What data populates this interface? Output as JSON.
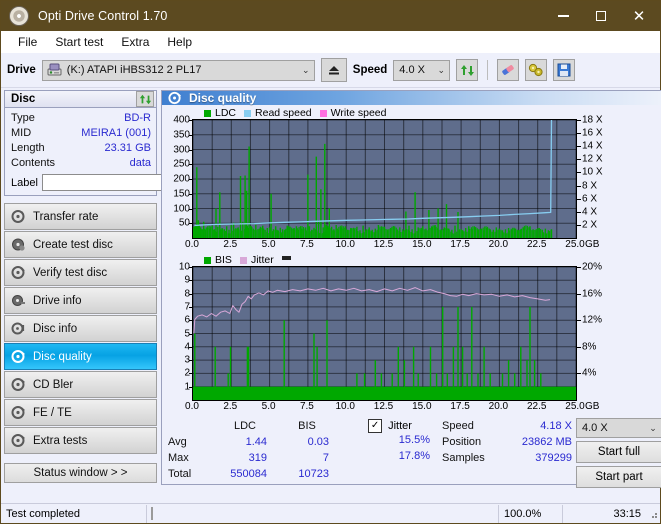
{
  "window": {
    "title": "Opti Drive Control 1.70",
    "icon": "disc-icon",
    "minimize": "minimize-icon",
    "maximize": "maximize-icon",
    "close": "close-icon"
  },
  "menu": {
    "items": [
      "File",
      "Start test",
      "Extra",
      "Help"
    ]
  },
  "toolbar": {
    "drive_label": "Drive",
    "drive_value": "(K:)  ATAPI iHBS312  2 PL17",
    "eject_icon": "eject-icon",
    "speed_label": "Speed",
    "speed_value": "4.0 X",
    "refresh_icon": "refresh-icon",
    "erase_icon": "eraser-icon",
    "disc_tools_icon": "disc-tools-icon",
    "save_icon": "save-icon"
  },
  "disc_panel": {
    "header": "Disc",
    "refresh_icon": "refresh-icon",
    "rows": [
      {
        "key": "Type",
        "value": "BD-R"
      },
      {
        "key": "MID",
        "value": "MEIRA1 (001)"
      },
      {
        "key": "Length",
        "value": "23.31 GB"
      },
      {
        "key": "Contents",
        "value": "data"
      }
    ],
    "label_key": "Label",
    "label_value": "",
    "label_placeholder": "",
    "label_button_icon": "cd-icon"
  },
  "sidebar": {
    "items": [
      {
        "label": "Transfer rate",
        "icon": "disc-transfer-icon",
        "active": false
      },
      {
        "label": "Create test disc",
        "icon": "disc-create-icon",
        "active": false
      },
      {
        "label": "Verify test disc",
        "icon": "disc-verify-icon",
        "active": false
      },
      {
        "label": "Drive info",
        "icon": "disc-drive-icon",
        "active": false
      },
      {
        "label": "Disc info",
        "icon": "disc-info-icon",
        "active": false
      },
      {
        "label": "Disc quality",
        "icon": "disc-quality-icon",
        "active": true
      },
      {
        "label": "CD Bler",
        "icon": "disc-bler-icon",
        "active": false
      },
      {
        "label": "FE / TE",
        "icon": "disc-fete-icon",
        "active": false
      },
      {
        "label": "Extra tests",
        "icon": "disc-extra-icon",
        "active": false
      }
    ],
    "status_button": "Status window > >"
  },
  "main": {
    "header": "Disc quality",
    "header_icon": "disc-quality-icon"
  },
  "stats": {
    "columns": [
      "LDC",
      "BIS"
    ],
    "rows": [
      {
        "label": "Avg",
        "ldc": "1.44",
        "bis": "0.03",
        "jitter": "15.5%"
      },
      {
        "label": "Max",
        "ldc": "319",
        "bis": "7",
        "jitter": "17.8%"
      },
      {
        "label": "Total",
        "ldc": "550084",
        "bis": "10723",
        "jitter": ""
      }
    ],
    "jitter_label": "Jitter",
    "jitter_checked": "✓",
    "speed_key": "Speed",
    "speed_value": "4.18 X",
    "position_key": "Position",
    "position_value": "23862 MB",
    "samples_key": "Samples",
    "samples_value": "379299",
    "speed_select": "4.0 X",
    "start_full": "Start full",
    "start_part": "Start part"
  },
  "statusbar": {
    "message": "Test completed",
    "percent_label": "100.0%",
    "percent_value": 100,
    "elapsed": "33:15"
  },
  "colors": {
    "ldc_green": "#00a800",
    "read_speed_blue": "#87cdf0",
    "write_speed_pink": "#ff6ee0",
    "jitter_pink": "#d8a8d8",
    "plot_bg": "#5f6d8c",
    "accent_blue": "#2a2ad0",
    "title_bar": "#5c4a20"
  },
  "chart_data": [
    {
      "type": "line",
      "name": "ldc-chart",
      "title": "",
      "xlabel": "GB",
      "ylabel": "",
      "xlim": [
        0,
        25
      ],
      "ylim": [
        0,
        400
      ],
      "y2lim": [
        0,
        18
      ],
      "y2label": "X",
      "grid": true,
      "legend": [
        {
          "label": "LDC",
          "color": "#00a800"
        },
        {
          "label": "Read speed",
          "color": "#87cdf0"
        },
        {
          "label": "Write speed",
          "color": "#ff6ee0"
        }
      ],
      "xticks": [
        0.0,
        2.5,
        5.0,
        7.5,
        10.0,
        12.5,
        15.0,
        17.5,
        20.0,
        22.5,
        25.0
      ],
      "xtick_labels": [
        "0.0",
        "2.5",
        "5.0",
        "7.5",
        "10.0",
        "12.5",
        "15.0",
        "17.5",
        "20.0",
        "22.5",
        "25.0"
      ],
      "yticks": [
        50,
        100,
        150,
        200,
        250,
        300,
        350,
        400
      ],
      "y2ticks": [
        2,
        4,
        6,
        8,
        10,
        12,
        14,
        16,
        18
      ],
      "y2tick_labels": [
        "2 X",
        "4 X",
        "6 X",
        "8 X",
        "10 X",
        "12 X",
        "14 X",
        "16 X",
        "18 X"
      ],
      "series": [
        {
          "name": "LDC",
          "color": "#00a800",
          "style": "impulse",
          "x": [
            0.05,
            0.15,
            0.25,
            0.35,
            0.42,
            0.5,
            0.6,
            0.7,
            0.8,
            0.95,
            1.1,
            1.25,
            1.4,
            1.5,
            1.62,
            1.75,
            1.9,
            2.05,
            2.2,
            2.35,
            2.5,
            2.65,
            2.8,
            2.95,
            3.1,
            3.25,
            3.4,
            3.5,
            3.58,
            3.66,
            3.8,
            3.95,
            4.1,
            4.25,
            4.4,
            4.55,
            4.7,
            4.85,
            5.0,
            5.1,
            5.25,
            5.4,
            5.55,
            5.7,
            5.85,
            6.0,
            6.15,
            6.3,
            6.45,
            6.6,
            6.75,
            6.9,
            7.05,
            7.2,
            7.35,
            7.5,
            7.6,
            7.75,
            7.9,
            8.05,
            8.2,
            8.35,
            8.5,
            8.6,
            8.7,
            8.8,
            8.9,
            9.05,
            9.2,
            9.35,
            9.5,
            9.65,
            9.8,
            9.95,
            10.1,
            10.3,
            10.5,
            10.7,
            10.9,
            11.1,
            11.3,
            11.5,
            11.7,
            11.9,
            12.1,
            12.3,
            12.5,
            12.7,
            12.9,
            13.1,
            13.3,
            13.5,
            13.7,
            13.9,
            14.1,
            14.3,
            14.5,
            14.7,
            14.9,
            15.0,
            15.2,
            15.4,
            15.6,
            15.8,
            16.0,
            16.2,
            16.4,
            16.55,
            16.7,
            16.9,
            17.1,
            17.3,
            17.5,
            17.6,
            17.8,
            18.0,
            18.2,
            18.4,
            18.6,
            18.8,
            19.0,
            19.2,
            19.4,
            19.6,
            19.8,
            20.0,
            20.2,
            20.4,
            20.6,
            20.8,
            21.0,
            21.2,
            21.4,
            21.6,
            21.8,
            22.0,
            22.2,
            22.4,
            22.6,
            22.8,
            23.0,
            23.2,
            23.4
          ],
          "y": [
            38,
            42,
            240,
            60,
            45,
            36,
            30,
            55,
            28,
            34,
            32,
            42,
            30,
            100,
            38,
            155,
            34,
            30,
            40,
            28,
            44,
            52,
            30,
            36,
            210,
            55,
            212,
            160,
            34,
            310,
            40,
            28,
            45,
            30,
            38,
            42,
            28,
            34,
            36,
            150,
            30,
            40,
            26,
            35,
            30,
            28,
            42,
            36,
            30,
            34,
            40,
            28,
            32,
            30,
            36,
            215,
            40,
            28,
            35,
            276,
            60,
            165,
            36,
            319,
            45,
            40,
            100,
            38,
            30,
            44,
            28,
            36,
            32,
            40,
            28,
            34,
            30,
            38,
            26,
            42,
            30,
            36,
            28,
            32,
            44,
            30,
            38,
            26,
            34,
            40,
            28,
            36,
            30,
            90,
            42,
            30,
            155,
            36,
            28,
            40,
            32,
            95,
            38,
            44,
            100,
            30,
            36,
            115,
            32,
            28,
            42,
            88,
            30,
            26,
            34,
            40,
            30,
            36,
            28,
            32,
            26,
            34,
            30,
            28,
            36,
            32,
            26,
            30,
            34,
            28,
            32,
            26,
            30,
            36,
            28,
            40,
            30,
            26,
            34,
            28,
            32,
            26,
            30
          ]
        },
        {
          "name": "Read speed",
          "color": "#87cdf0",
          "style": "line",
          "axis": "right",
          "x": [
            0.1,
            1.0,
            2.0,
            3.0,
            4.0,
            5.0,
            6.0,
            7.0,
            8.0,
            9.0,
            10.0,
            11.0,
            12.0,
            13.0,
            14.0,
            15.0,
            16.0,
            17.0,
            18.0,
            19.0,
            20.0,
            21.0,
            22.0,
            22.9,
            23.35,
            23.4
          ],
          "y": [
            1.9,
            2.05,
            2.1,
            2.15,
            2.2,
            2.3,
            2.4,
            2.45,
            2.55,
            2.62,
            2.7,
            2.75,
            2.8,
            2.85,
            2.9,
            3.0,
            3.08,
            3.15,
            3.25,
            3.35,
            3.45,
            3.6,
            3.72,
            3.85,
            3.9,
            18.0
          ]
        }
      ]
    },
    {
      "type": "line",
      "name": "bis-jitter-chart",
      "title": "",
      "xlabel": "GB",
      "ylabel": "",
      "xlim": [
        0,
        25
      ],
      "ylim": [
        0,
        10
      ],
      "y2lim": [
        0,
        20
      ],
      "y2label": "%",
      "grid": true,
      "legend": [
        {
          "label": "BIS",
          "color": "#00a800"
        },
        {
          "label": "Jitter",
          "color": "#d8a8d8"
        }
      ],
      "xticks": [
        0.0,
        2.5,
        5.0,
        7.5,
        10.0,
        12.5,
        15.0,
        17.5,
        20.0,
        22.5,
        25.0
      ],
      "xtick_labels": [
        "0.0",
        "2.5",
        "5.0",
        "7.5",
        "10.0",
        "12.5",
        "15.0",
        "17.5",
        "20.0",
        "22.5",
        "25.0"
      ],
      "yticks": [
        1,
        2,
        3,
        4,
        5,
        6,
        7,
        8,
        9,
        10
      ],
      "y2ticks": [
        4,
        8,
        12,
        16,
        20
      ],
      "y2tick_labels": [
        "4%",
        "8%",
        "12%",
        "16%",
        "20%"
      ],
      "series": [
        {
          "name": "BIS",
          "color": "#00a800",
          "style": "impulse",
          "baseline": 1,
          "x": [
            0.12,
            0.5,
            1.0,
            1.45,
            1.8,
            2.3,
            2.45,
            2.9,
            3.3,
            3.55,
            3.62,
            4.1,
            4.6,
            5.0,
            5.4,
            5.95,
            6.4,
            6.9,
            7.4,
            7.9,
            8.1,
            8.45,
            8.75,
            9.2,
            9.7,
            10.2,
            10.7,
            11.2,
            11.5,
            11.9,
            12.3,
            12.6,
            13.0,
            13.4,
            13.8,
            14.1,
            14.4,
            14.7,
            15.1,
            15.5,
            15.9,
            16.3,
            16.6,
            17.0,
            17.3,
            17.6,
            17.9,
            18.2,
            18.6,
            19.0,
            19.4,
            19.8,
            20.2,
            20.6,
            21.0,
            21.4,
            21.8,
            22.0,
            22.3,
            22.7,
            23.0,
            23.3
          ],
          "y": [
            5,
            1,
            1,
            4,
            1,
            2,
            4,
            1,
            1,
            4,
            4,
            1,
            1,
            1,
            1,
            6,
            1,
            1,
            1,
            5,
            4,
            1,
            6,
            1,
            1,
            1,
            2,
            2,
            1,
            3,
            2,
            1,
            2,
            4,
            3,
            1,
            4,
            2,
            1,
            4,
            2,
            7,
            2,
            4,
            7,
            4,
            2,
            7,
            2,
            4,
            2,
            1,
            2,
            3,
            2,
            4,
            3,
            7,
            3,
            2,
            1,
            1
          ]
        },
        {
          "name": "Jitter",
          "color": "#d8a8d8",
          "style": "line",
          "axis": "right",
          "x": [
            0.05,
            0.12,
            0.3,
            0.6,
            0.9,
            1.2,
            1.5,
            1.8,
            2.1,
            2.4,
            2.6,
            2.8,
            3.0,
            3.2,
            3.4,
            3.6,
            3.8,
            4.0,
            4.3,
            4.6,
            4.9,
            5.2,
            5.5,
            6.0,
            6.5,
            7.0,
            7.5,
            8.0,
            8.5,
            9.0,
            9.5,
            10.0,
            10.5,
            11.0,
            11.5,
            12.0,
            12.5,
            13.0,
            13.5,
            14.0,
            14.5,
            15.0,
            15.5,
            16.0,
            16.4,
            16.8,
            17.2,
            17.6,
            18.0,
            18.5,
            19.0,
            19.5,
            20.0,
            20.5,
            21.0,
            21.5,
            22.0,
            22.5,
            23.0,
            23.3
          ],
          "y": [
            10.0,
            12.1,
            12.6,
            12.8,
            12.5,
            13.0,
            12.6,
            13.2,
            13.4,
            13.0,
            14.2,
            13.6,
            13.2,
            14.4,
            14.8,
            15.6,
            15.2,
            15.8,
            16.1,
            15.8,
            16.4,
            16.2,
            16.5,
            16.3,
            16.6,
            16.4,
            16.7,
            16.5,
            16.8,
            16.4,
            16.7,
            16.5,
            16.8,
            16.4,
            16.6,
            16.3,
            16.7,
            16.4,
            16.8,
            16.5,
            16.9,
            16.4,
            16.6,
            16.2,
            16.0,
            15.7,
            15.6,
            15.9,
            15.7,
            16.0,
            15.8,
            15.9,
            15.6,
            15.8,
            15.5,
            15.7,
            15.4,
            15.2,
            15.0,
            15.1
          ]
        }
      ]
    }
  ]
}
